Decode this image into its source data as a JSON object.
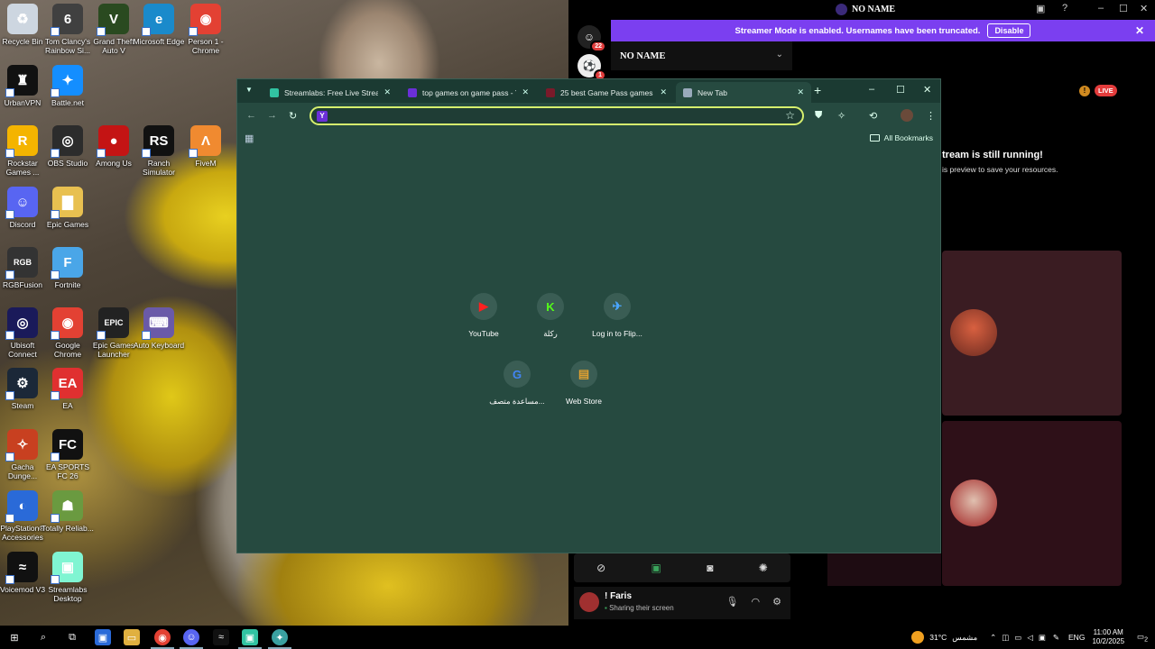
{
  "desktop_icons": [
    {
      "label": "Recycle Bin",
      "icon": "recycle-bin-icon",
      "color": "#cdd6e0",
      "glyph": "♻"
    },
    {
      "label": "Tom Clancy's Rainbow Si...",
      "icon": "rainbow-six-icon",
      "color": "#404040",
      "glyph": "6"
    },
    {
      "label": "Grand Theft Auto V",
      "icon": "gta-v-icon",
      "color": "#2a4a20",
      "glyph": "V"
    },
    {
      "label": "Microsoft Edge",
      "icon": "edge-icon",
      "color": "#1a8acb",
      "glyph": "e"
    },
    {
      "label": "Person 1 - Chrome",
      "icon": "chrome-profile-icon",
      "color": "#e34133",
      "glyph": "◉"
    },
    {
      "label": "UrbanVPN",
      "icon": "urbanvpn-icon",
      "color": "#111",
      "glyph": "♜"
    },
    {
      "label": "Battle.net",
      "icon": "battlenet-icon",
      "color": "#148eff",
      "glyph": "✦"
    },
    {
      "label": "Rockstar Games ...",
      "icon": "rockstar-icon",
      "color": "#f4b400",
      "glyph": "R"
    },
    {
      "label": "OBS Studio",
      "icon": "obs-icon",
      "color": "#2c2c2c",
      "glyph": "◎"
    },
    {
      "label": "Among Us",
      "icon": "among-us-icon",
      "color": "#c41414",
      "glyph": "●"
    },
    {
      "label": "Ranch Simulator",
      "icon": "ranch-simulator-icon",
      "color": "#111",
      "glyph": "RS"
    },
    {
      "label": "FiveM",
      "icon": "fivem-icon",
      "color": "#f08a30",
      "glyph": "Λ"
    },
    {
      "label": "Discord",
      "icon": "discord-icon",
      "color": "#5865f2",
      "glyph": "☺"
    },
    {
      "label": "Epic Games",
      "icon": "folder-icon",
      "color": "#e8c050",
      "glyph": "▇"
    },
    {
      "label": "RGBFusion",
      "icon": "rgbfusion-icon",
      "color": "#333",
      "glyph": "RGB"
    },
    {
      "label": "Fortnite",
      "icon": "fortnite-icon",
      "color": "#4aa6e8",
      "glyph": "F"
    },
    {
      "label": "Ubisoft Connect",
      "icon": "ubisoft-icon",
      "color": "#1a1a5a",
      "glyph": "◎"
    },
    {
      "label": "Google Chrome",
      "icon": "chrome-icon",
      "color": "#e34133",
      "glyph": "◉"
    },
    {
      "label": "Epic Games Launcher",
      "icon": "epic-games-icon",
      "color": "#222",
      "glyph": "EPIC"
    },
    {
      "label": "Auto Keyboard",
      "icon": "auto-keyboard-icon",
      "color": "#6a5aa8",
      "glyph": "⌨"
    },
    {
      "label": "Steam",
      "icon": "steam-icon",
      "color": "#1b2838",
      "glyph": "⚙"
    },
    {
      "label": "EA",
      "icon": "ea-icon",
      "color": "#e03030",
      "glyph": "EA"
    },
    {
      "label": "Gacha Dunge...",
      "icon": "gacha-dungeon-icon",
      "color": "#c84020",
      "glyph": "✧"
    },
    {
      "label": "EA SPORTS FC 26",
      "icon": "ea-fc-icon",
      "color": "#111",
      "glyph": "FC"
    },
    {
      "label": "PlayStation® Accessories",
      "icon": "playstation-accessories-icon",
      "color": "#2a6ad8",
      "glyph": "◐"
    },
    {
      "label": "Totally Reliab...",
      "icon": "totally-reliable-icon",
      "color": "#6a9a40",
      "glyph": "☗"
    },
    {
      "label": "Voicemod V3",
      "icon": "voicemod-icon",
      "color": "#111",
      "glyph": "≈"
    },
    {
      "label": "Streamlabs Desktop",
      "icon": "streamlabs-icon",
      "color": "#80f5d2",
      "glyph": "▣"
    }
  ],
  "discord": {
    "server_name": "NO NAME",
    "streamer_banner": "Streamer Mode is enabled. Usernames have been truncated.",
    "disable_label": "Disable",
    "channel_header": "NO NAME",
    "badge1": "22",
    "badge2": "1",
    "live_label": "LIVE",
    "stream_running_title": "tream is still running!",
    "stream_running_sub": "is preview to save your resources.",
    "user_name": "! Faris",
    "user_status": "Sharing their screen"
  },
  "chrome": {
    "tabs": [
      {
        "title": "Streamlabs: Free Live Streamin",
        "fav_color": "#31c3a2",
        "fav": "streamlabs-favicon"
      },
      {
        "title": "top games on game pass - Yaho",
        "fav_color": "#6b2fd8",
        "fav": "yahoo-favicon"
      },
      {
        "title": "25 best Game Pass games on",
        "fav_color": "#7a1a2a",
        "fav": "site-favicon"
      },
      {
        "title": "New Tab",
        "fav_color": "#9ab",
        "fav": "newtab-favicon"
      }
    ],
    "omnibox_value": "",
    "all_bookmarks": "All Bookmarks",
    "shortcuts": [
      {
        "label": "YouTube",
        "icon": "youtube-icon",
        "glyph": "▶",
        "color": "#ff2020"
      },
      {
        "label": "ركلة",
        "icon": "kick-icon",
        "glyph": "K",
        "color": "#53fc18"
      },
      {
        "label": "Log in to Flip...",
        "icon": "flip-icon",
        "glyph": "✈",
        "color": "#4aa6ff"
      },
      {
        "label": "مساعدة متصف...",
        "icon": "google-icon",
        "glyph": "G",
        "color": "#4285f4"
      },
      {
        "label": "Web Store",
        "icon": "web-store-icon",
        "glyph": "▤",
        "color": "#e0a030"
      }
    ]
  },
  "taskbar": {
    "weather": "31°C",
    "weather_text": "مشمس",
    "lang": "ENG",
    "time": "11:00 AM",
    "date": "10/2/2025",
    "notif": "2"
  }
}
